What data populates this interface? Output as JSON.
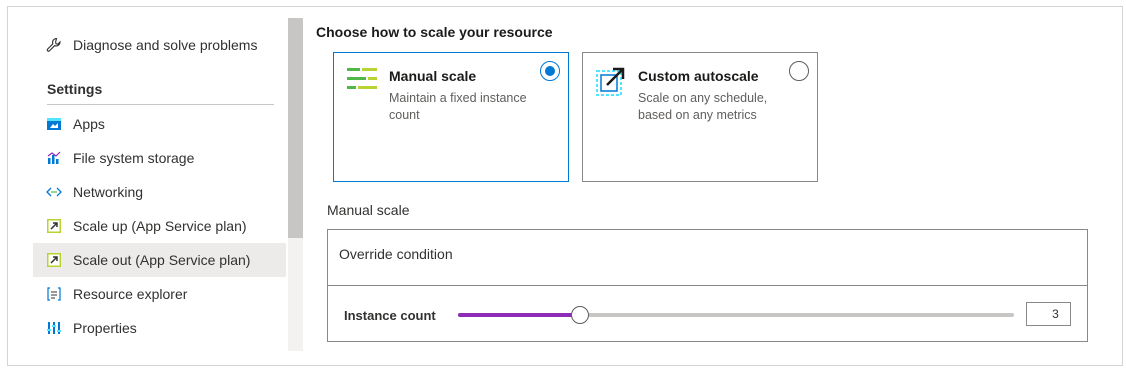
{
  "sidebar": {
    "items_top": [
      {
        "label": "Diagnose and solve problems",
        "icon": "wrench-icon"
      }
    ],
    "section_title": "Settings",
    "items": [
      {
        "label": "Apps",
        "icon": "apps-icon",
        "selected": false
      },
      {
        "label": "File system storage",
        "icon": "storage-chart-icon",
        "selected": false
      },
      {
        "label": "Networking",
        "icon": "networking-icon",
        "selected": false
      },
      {
        "label": "Scale up (App Service plan)",
        "icon": "scale-up-icon",
        "selected": false
      },
      {
        "label": "Scale out (App Service plan)",
        "icon": "scale-out-icon",
        "selected": true
      },
      {
        "label": "Resource explorer",
        "icon": "resource-explorer-icon",
        "selected": false
      },
      {
        "label": "Properties",
        "icon": "properties-icon",
        "selected": false
      }
    ]
  },
  "main": {
    "title": "Choose how to scale your resource",
    "options": [
      {
        "title": "Manual scale",
        "description": "Maintain a fixed instance count",
        "selected": true,
        "icon": "manual-scale-icon"
      },
      {
        "title": "Custom autoscale",
        "description": "Scale on any schedule, based on any metrics",
        "selected": false,
        "icon": "custom-autoscale-icon"
      }
    ],
    "manual_section_label": "Manual scale",
    "override_condition": "Override condition",
    "instance_count_label": "Instance count",
    "instance_count_value": "3",
    "slider_fraction": 0.22
  },
  "colors": {
    "accent": "#0078d4",
    "slider_fill": "#8e2bb7",
    "selected_bg": "#edebe9"
  }
}
